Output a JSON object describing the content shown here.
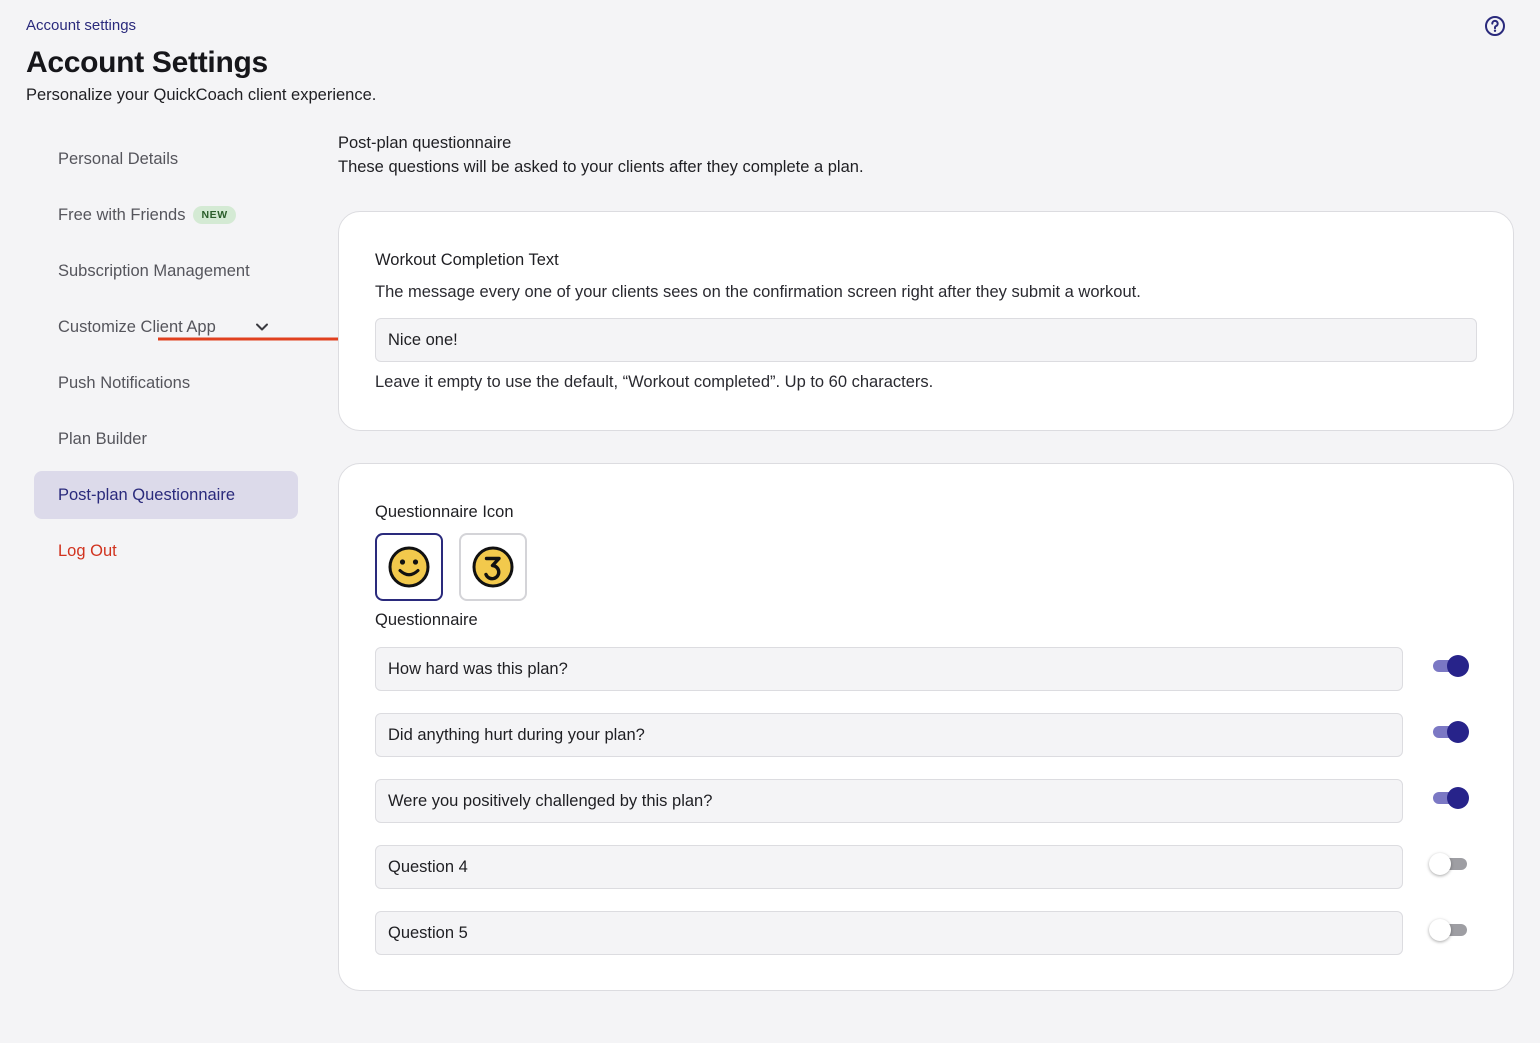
{
  "breadcrumb": "Account settings",
  "header": {
    "title": "Account Settings",
    "subtitle": "Personalize your QuickCoach client experience."
  },
  "sidebar": {
    "items": [
      {
        "label": "Personal Details"
      },
      {
        "label": "Free with Friends",
        "badge": "NEW"
      },
      {
        "label": "Subscription Management"
      },
      {
        "label": "Customize Client App"
      },
      {
        "label": "Push Notifications"
      },
      {
        "label": "Plan Builder"
      },
      {
        "label": "Post-plan Questionnaire"
      },
      {
        "label": "Log Out"
      }
    ],
    "active_index": 6
  },
  "main": {
    "section_title": "Post-plan questionnaire",
    "section_description": "These questions will be asked to your clients after they complete a plan.",
    "completion_card": {
      "label": "Workout Completion Text",
      "description": "The message every one of your clients sees on the confirmation screen right after they submit a workout.",
      "input_value": "Nice one!",
      "hint": "Leave it empty to use the default, “Workout completed”. Up to 60 characters."
    },
    "questionnaire_card": {
      "icon_label": "Questionnaire Icon",
      "icons": [
        {
          "name": "smiley-face-icon",
          "selected": true
        },
        {
          "name": "number-three-icon",
          "selected": false
        }
      ],
      "questions_label": "Questionnaire",
      "questions": [
        {
          "text": "How hard was this plan?",
          "enabled": true
        },
        {
          "text": "Did anything hurt during your plan?",
          "enabled": true
        },
        {
          "text": "Were you positively challenged by this plan?",
          "enabled": true
        },
        {
          "text": "Question 4",
          "enabled": false
        },
        {
          "text": "Question 5",
          "enabled": false
        }
      ]
    }
  },
  "colors": {
    "accent": "#27238a",
    "accent_light": "#7b78c4",
    "active_bg": "#dcdaea",
    "danger": "#d1331f",
    "annotation_arrow": "#e0401f",
    "icon_yellow": "#f2c94c"
  }
}
